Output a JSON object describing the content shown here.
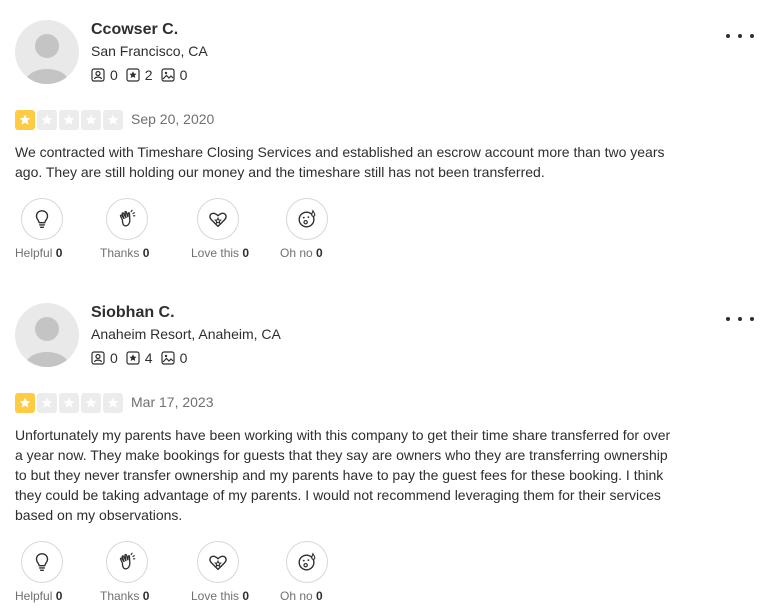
{
  "colors": {
    "star_filled": "#fecb42",
    "star_empty": "#ececec",
    "text": "#2d2e2f",
    "muted": "#6e7072"
  },
  "reviews": [
    {
      "user_name": "Ccowser C.",
      "location": "San Francisco, CA",
      "stats": {
        "friends": "0",
        "reviews": "2",
        "photos": "0"
      },
      "rating": 1,
      "date": "Sep 20, 2020",
      "text": "We contracted with Timeshare Closing Services and established an escrow account more than two years ago. They are still holding our money and the timeshare still has not been transferred.",
      "reactions": [
        {
          "label": "Helpful",
          "count": "0",
          "icon": "lightbulb-icon"
        },
        {
          "label": "Thanks",
          "count": "0",
          "icon": "clapping-hands-icon"
        },
        {
          "label": "Love this",
          "count": "0",
          "icon": "heart-icon"
        },
        {
          "label": "Oh no",
          "count": "0",
          "icon": "surprised-face-icon"
        }
      ]
    },
    {
      "user_name": "Siobhan C.",
      "location": "Anaheim Resort, Anaheim, CA",
      "stats": {
        "friends": "0",
        "reviews": "4",
        "photos": "0"
      },
      "rating": 1,
      "date": "Mar 17, 2023",
      "text": "Unfortunately my parents have been working with this company to get their time share transferred for over a year now. They make bookings for guests that they say are owners who they are transferring ownership to but they never transfer ownership and my parents have to pay the guest fees for these booking. I think they could be taking advantage of my parents. I would not recommend leveraging them for their services based on my observations.",
      "reactions": [
        {
          "label": "Helpful",
          "count": "0",
          "icon": "lightbulb-icon"
        },
        {
          "label": "Thanks",
          "count": "0",
          "icon": "clapping-hands-icon"
        },
        {
          "label": "Love this",
          "count": "0",
          "icon": "heart-icon"
        },
        {
          "label": "Oh no",
          "count": "0",
          "icon": "surprised-face-icon"
        }
      ]
    }
  ]
}
